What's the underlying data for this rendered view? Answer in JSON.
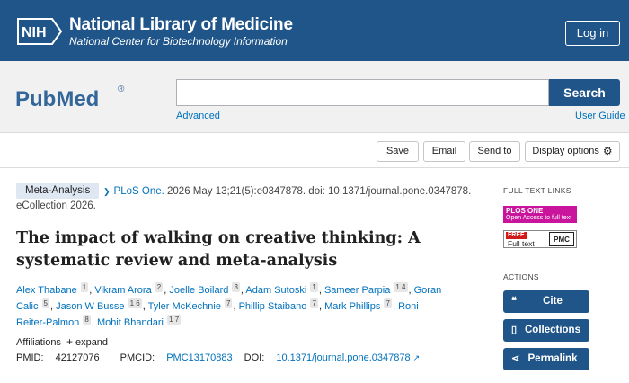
{
  "header": {
    "logo_text": "NIH",
    "title": "National Library of Medicine",
    "subtitle": "National Center for Biotechnology Information",
    "login_label": "Log in"
  },
  "search": {
    "logo_text": "PubMed",
    "logo_mark": "®",
    "value": "",
    "placeholder": "",
    "button_label": "Search",
    "advanced_label": "Advanced",
    "user_guide_label": "User Guide"
  },
  "actions": {
    "save": "Save",
    "email": "Email",
    "send_to": "Send to",
    "display_options": "Display options"
  },
  "article": {
    "type_badge": "Meta-Analysis",
    "journal": "PLoS One.",
    "citation_rest": "2026 May 13;21(5):e0347878. doi: 10.1371/journal.pone.0347878.",
    "citation_line2": "eCollection 2026.",
    "title": "The impact of walking on creative thinking: A systematic review and meta-analysis",
    "authors": [
      {
        "name": "Alex Thabane",
        "aff": "1"
      },
      {
        "name": "Vikram Arora",
        "aff": "2"
      },
      {
        "name": "Joelle Boilard",
        "aff": "3"
      },
      {
        "name": "Adam Sutoski",
        "aff": "1"
      },
      {
        "name": "Sameer Parpia",
        "aff": "1 4"
      },
      {
        "name": "Goran Calic",
        "aff": "5"
      },
      {
        "name": "Jason W Busse",
        "aff": "1 6"
      },
      {
        "name": "Tyler McKechnie",
        "aff": "7"
      },
      {
        "name": "Phillip Staibano",
        "aff": "7"
      },
      {
        "name": "Mark Phillips",
        "aff": "7"
      },
      {
        "name": "Roni Reiter-Palmon",
        "aff": "8"
      },
      {
        "name": "Mohit Bhandari",
        "aff": "1 7"
      }
    ],
    "affiliations_label": "Affiliations",
    "expand_label": "expand",
    "pmid_label": "PMID:",
    "pmid": "42127076",
    "pmcid_label": "PMCID:",
    "pmcid": "PMC13170883",
    "doi_label": "DOI:",
    "doi": "10.1371/journal.pone.0347878"
  },
  "sidebar": {
    "full_text_heading": "FULL TEXT LINKS",
    "plos_title": "PLOS ONE",
    "plos_sub": "Open Access to full text",
    "pmc_free": "FREE",
    "pmc_full": "Full text",
    "pmc_logo": "PMC",
    "actions_heading": "ACTIONS",
    "cite": "Cite",
    "collections": "Collections",
    "permalink": "Permalink"
  },
  "colors": {
    "header_blue": "#20558a",
    "link_blue": "#0071bc",
    "plos_magenta": "#c9159b",
    "badge_bg": "#dfe8f2"
  }
}
